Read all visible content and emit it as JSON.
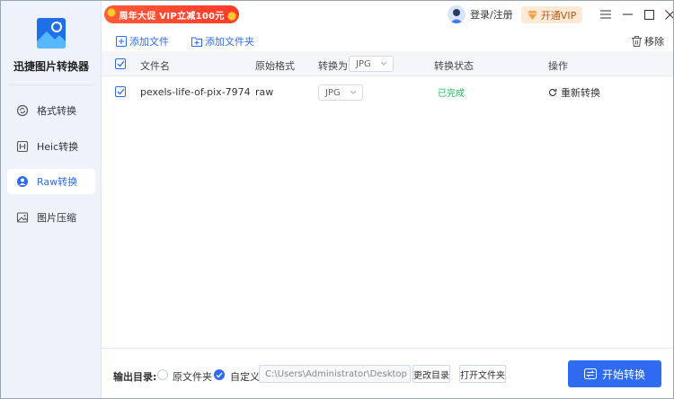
{
  "app": {
    "name": "迅捷图片转换器",
    "accent_color": "#2f6bf0"
  },
  "sidebar": {
    "items": [
      {
        "label": "格式转换",
        "icon": "refresh-circle-icon",
        "active": false
      },
      {
        "label": "Heic转换",
        "icon": "h-box-icon",
        "active": false
      },
      {
        "label": "Raw转换",
        "icon": "camera-lens-icon",
        "active": true
      },
      {
        "label": "图片压缩",
        "icon": "image-icon",
        "active": false
      }
    ]
  },
  "topbar": {
    "promo": "周年大促 VIP立减100元",
    "login": "登录/注册",
    "vip": "开通VIP"
  },
  "toolbar": {
    "add_file": "添加文件",
    "add_folder": "添加文件夹",
    "remove": "移除"
  },
  "table": {
    "headers": {
      "filename": "文件名",
      "original_format": "原始格式",
      "convert_to": "转换为",
      "status": "转换状态",
      "action": "操作"
    },
    "header_format_value": "JPG",
    "rows": [
      {
        "filename": "pexels-life-of-pix-7974",
        "original_format": "raw",
        "target_format": "JPG",
        "status": "已完成",
        "action": "重新转换",
        "checked": true
      }
    ]
  },
  "output": {
    "label": "输出目录:",
    "option_original": "原文件夹",
    "option_custom": "自定义",
    "path": "C:\\Users\\Administrator\\Desktop",
    "change_dir": "更改目录",
    "open_folder": "打开文件夹",
    "start": "开始转换"
  }
}
